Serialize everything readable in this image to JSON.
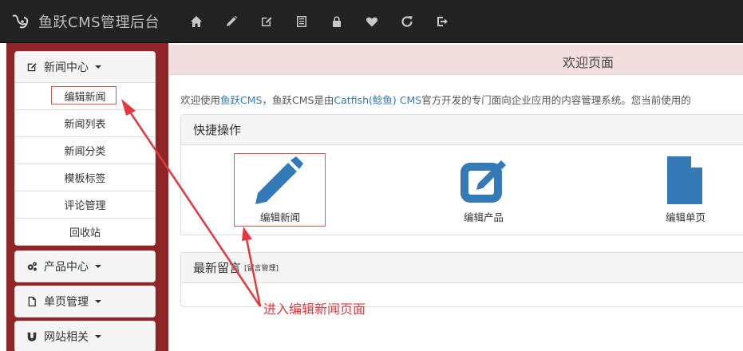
{
  "navbar": {
    "brand": "鱼跃CMS管理后台",
    "icons": [
      "home-icon",
      "pencil-icon",
      "edit-icon",
      "list-alt-icon",
      "lock-icon",
      "heart-icon",
      "refresh-icon",
      "logout-icon"
    ]
  },
  "sidebar": {
    "news": {
      "label": "新闻中心",
      "items": [
        "编辑新闻",
        "新闻列表",
        "新闻分类",
        "模板标签",
        "评论管理",
        "回收站"
      ]
    },
    "products": {
      "label": "产品中心"
    },
    "pages": {
      "label": "单页管理"
    },
    "site": {
      "label": "网站相关"
    }
  },
  "main": {
    "title": "欢迎页面",
    "welcome": {
      "t1": "欢迎使用",
      "link1": "鱼跃CMS",
      "t2": "，鱼跃CMS是由",
      "link2": "Catfish(鲶鱼) CMS",
      "t3": "官方开发的专门面向企业应用的内容管理系统。您当前使用的"
    },
    "quick": {
      "title": "快捷操作",
      "items": [
        "编辑新闻",
        "编辑产品",
        "编辑单页"
      ]
    },
    "messages": {
      "title": "最新留言",
      "sub": "[留言管理]"
    }
  },
  "annotation": {
    "callout": "进入编辑新闻页面"
  },
  "colors": {
    "navbar": "#222222",
    "sidebar": "#8f2527",
    "header": "#f2dede",
    "icon_blue": "#337ab7",
    "highlight": "#d9534f",
    "arrow": "#e0393e"
  }
}
